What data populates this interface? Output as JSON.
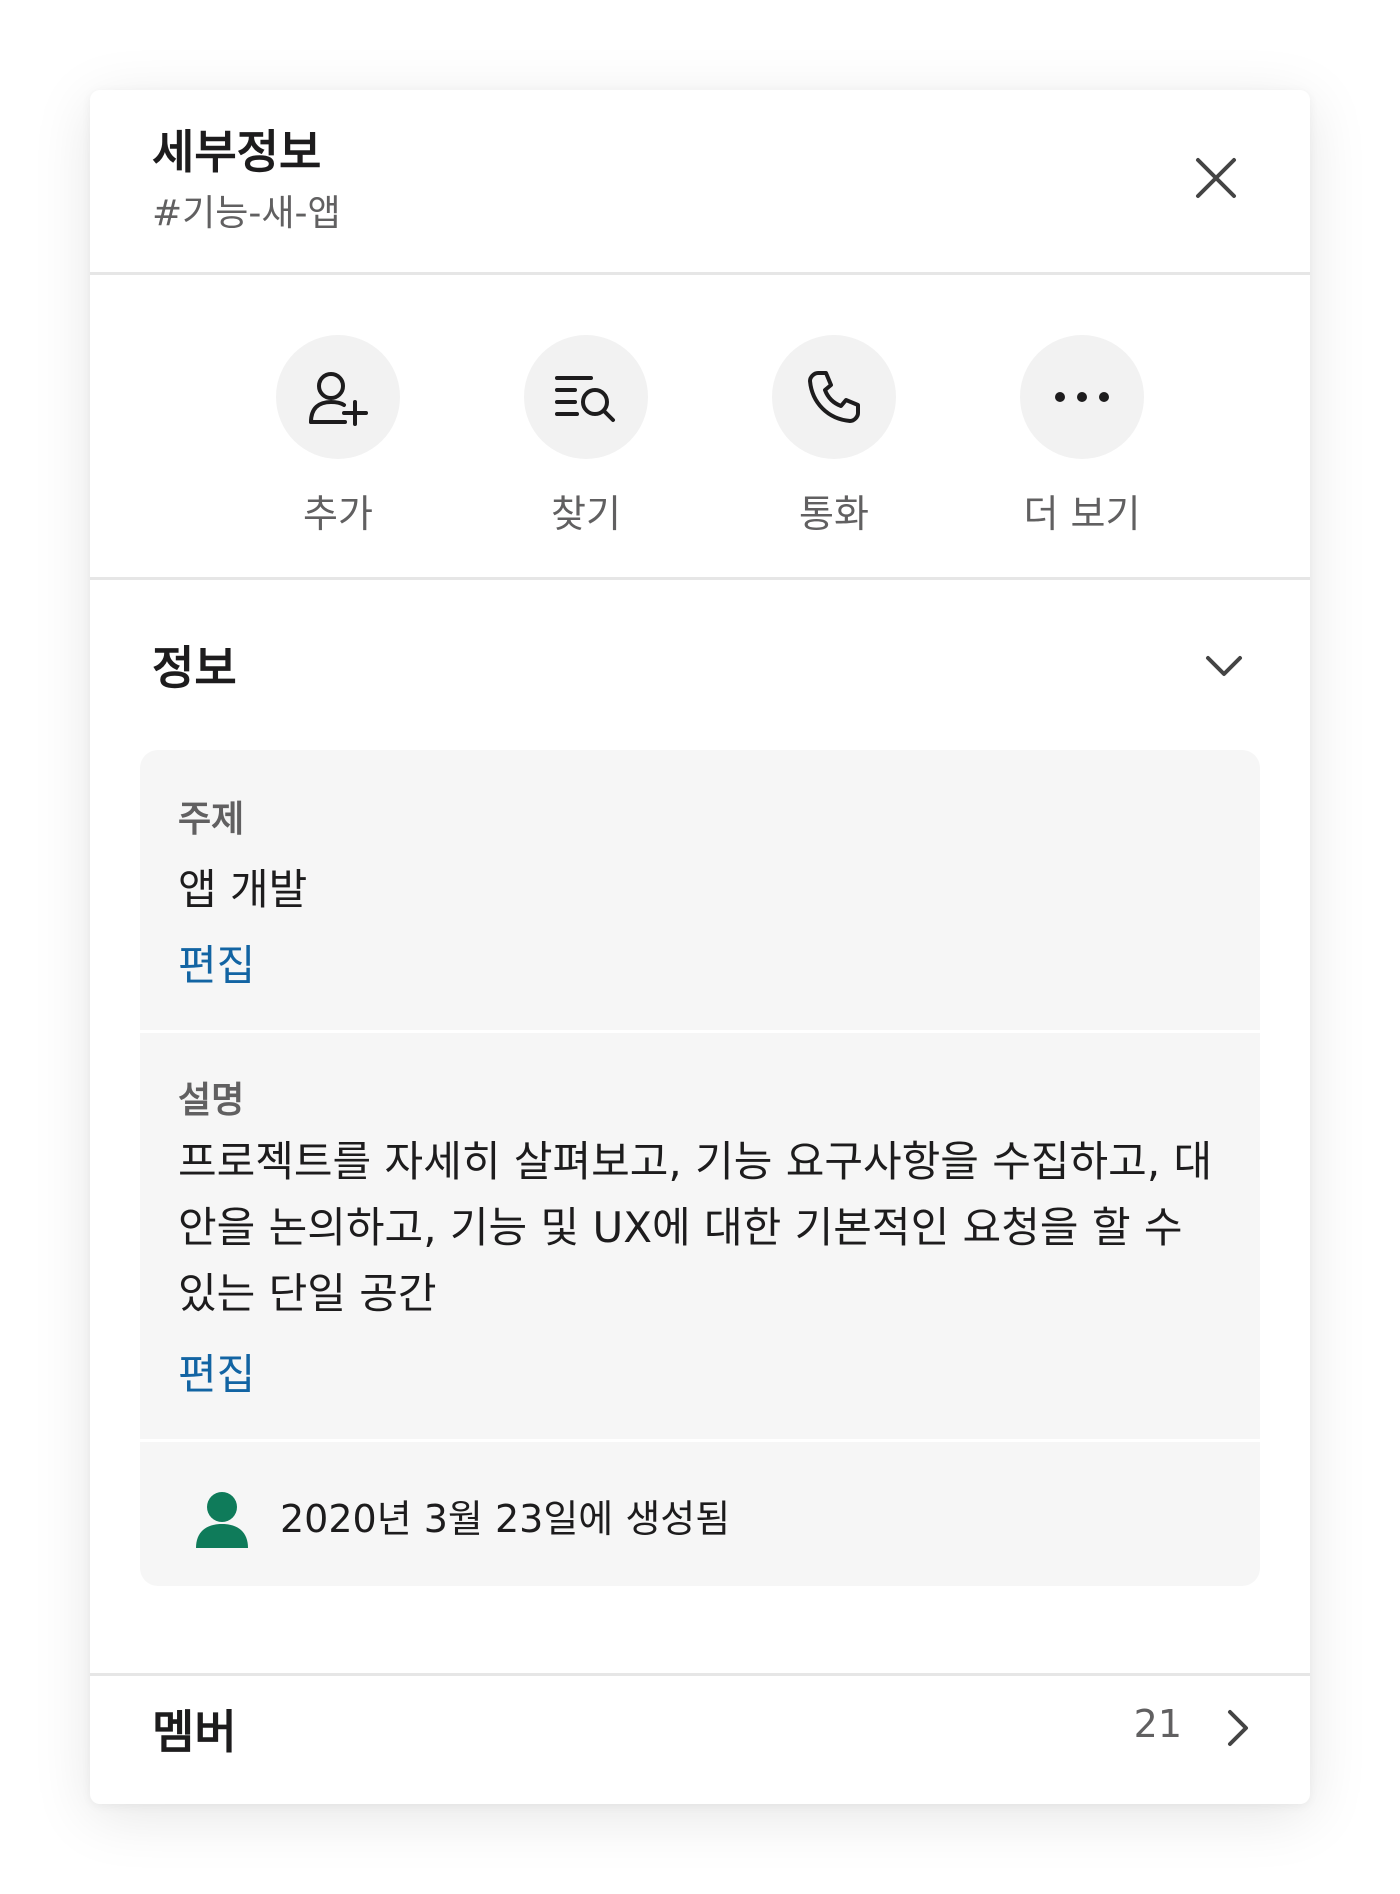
{
  "header": {
    "title": "세부정보",
    "channel": "#기능-새-앱"
  },
  "actions": [
    {
      "label": "추가",
      "icon": "add-person-icon"
    },
    {
      "label": "찾기",
      "icon": "search-list-icon"
    },
    {
      "label": "통화",
      "icon": "phone-icon"
    },
    {
      "label": "더 보기",
      "icon": "more-icon"
    }
  ],
  "info": {
    "title": "정보",
    "topic_label": "주제",
    "topic_value": "앱 개발",
    "description_label": "설명",
    "description_value": "프로젝트를 자세히 살펴보고, 기능 요구사항을 수집하고, 대안을 논의하고, 기능 및 UX에 대한 기본적인 요청을 할 수 있는 단일 공간",
    "edit_label": "편집",
    "created_text": "2020년 3월 23일에 생성됨"
  },
  "members": {
    "title": "멤버",
    "count": "21"
  },
  "colors": {
    "link": "#1264a3",
    "avatar": "#0f7b5a",
    "text": "#1d1c1d",
    "muted": "#616061"
  }
}
